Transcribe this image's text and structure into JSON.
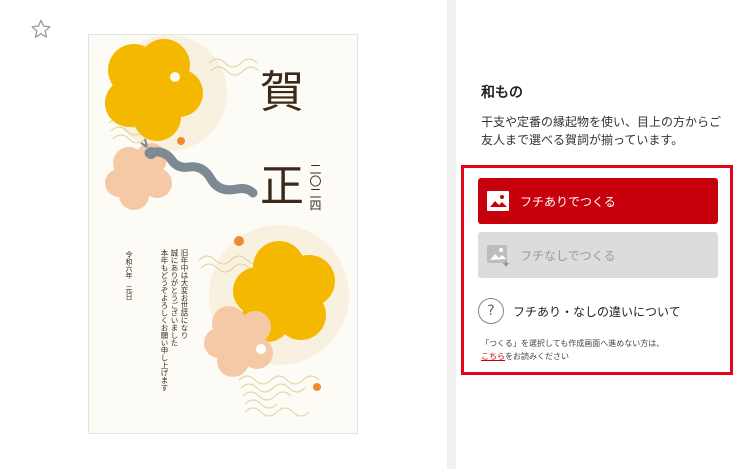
{
  "card": {
    "greeting_top": "賀",
    "greeting_bottom": "正",
    "year": "二〇二四",
    "message_line1": "旧年中は大変お世話になり",
    "message_line2": "誠にありがとうございました",
    "message_line3": "本年もどうぞよろしくお願い申し上げます",
    "date": "令和六年　元日"
  },
  "panel": {
    "title": "和もの",
    "description": "干支や定番の縁起物を使い、目上の方からご友人まで選べる賀詞が揃っています。",
    "button_with_border": "フチありでつくる",
    "button_without_border": "フチなしでつくる",
    "help_label": "フチあり・なしの違いについて",
    "note_prefix": "「つくる」を選択しても作成画面へ進めない方は、",
    "note_link": "こちら",
    "note_suffix": "をお読みください"
  },
  "icons": {
    "favorite": "star-outline-icon",
    "picture": "image-icon",
    "help": "question-circle-icon"
  },
  "colors": {
    "primary_red": "#c8000b",
    "highlight_red": "#e3061a",
    "disabled_gray": "#dcdcdc",
    "flower_yellow": "#f5b800",
    "flower_peach": "#f6c9a6",
    "dragon_gray": "#7d8a93",
    "text_brown": "#3b2a1a"
  }
}
